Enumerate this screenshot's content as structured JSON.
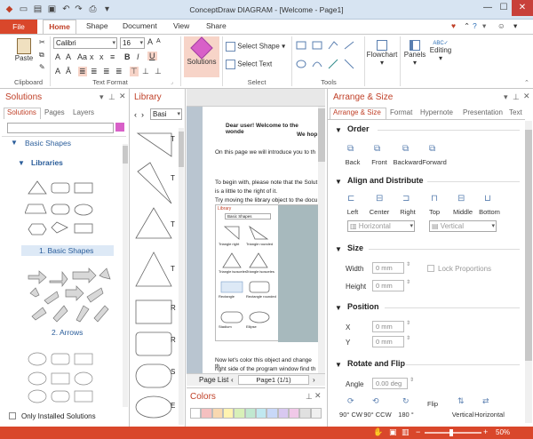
{
  "window": {
    "title": "ConceptDraw DIAGRAM - [Welcome - Page1]",
    "min": "—",
    "max": "☐",
    "close": "✕"
  },
  "tabs": {
    "file": "File",
    "home": "Home",
    "shape": "Shape",
    "document": "Document",
    "view": "View",
    "share": "Share"
  },
  "ribbon": {
    "paste": "Paste",
    "clipboard": "Clipboard",
    "font_name": "Calibri",
    "font_size": "16",
    "text_format": "Text Format",
    "solutions": "Solutions",
    "select_shape": "Select Shape",
    "select_text": "Select Text",
    "select": "Select",
    "tools": "Tools",
    "flowchart": "Flowchart",
    "panels": "Panels",
    "editing": "Editing"
  },
  "solutions": {
    "title": "Solutions",
    "tabs": [
      "Solutions",
      "Pages",
      "Layers"
    ],
    "basic_shapes": "Basic Shapes",
    "libraries": "Libraries",
    "lib1": "1. Basic Shapes",
    "lib2": "2. Arrows",
    "only_installed": "Only Installed Solutions"
  },
  "library": {
    "title": "Library",
    "combo": "Basi",
    "letters": [
      "T",
      "T",
      "T",
      "T",
      "R",
      "R",
      "S",
      "E"
    ]
  },
  "document_text": {
    "greet1": "Dear user! Welcome to the wonde",
    "greet2": "We hop",
    "intro": "On this page we will introduce you to th",
    "p1": "To begin with, please note that the Solut",
    "p2": "is a little to the right of it.",
    "p3": "Try moving the library object to the docu",
    "inner_lib": "Library",
    "inner_combo": "Basic Shapes",
    "inner_items": [
      "Triangle right",
      "Triangle rounded",
      "Triangle isosceles",
      "Triangle isosceles",
      "Rectangle",
      "Rectangle rounded",
      "Stadium",
      "Ellipse"
    ],
    "p4": "Now let's color this object and change th",
    "p5": "right side of the program window find th"
  },
  "page_nav": {
    "list": "Page List",
    "page": "Page1 (1/1)"
  },
  "colors": {
    "title": "Colors"
  },
  "arrange": {
    "title": "Arrange & Size",
    "tabs": [
      "Arrange & Size",
      "Format",
      "Hypernote",
      "Presentation",
      "Text"
    ],
    "order": "Order",
    "order_btns": [
      "Back",
      "Front",
      "Backward",
      "Forward"
    ],
    "align": "Align and Distribute",
    "align_btns": [
      "Left",
      "Center",
      "Right",
      "Top",
      "Middle",
      "Bottom"
    ],
    "horizontal": "Horizontal",
    "vertical": "Vertical",
    "size": "Size",
    "width": "Width",
    "height": "Height",
    "mm": "0 mm",
    "lock": "Lock Proportions",
    "position": "Position",
    "x": "X",
    "y": "Y",
    "rotate": "Rotate and Flip",
    "angle": "Angle",
    "deg": "0.00 deg",
    "rot_btns": [
      "90° CW",
      "90° CCW",
      "180 °",
      "Flip",
      "Vertical",
      "Horizontal"
    ]
  },
  "status": {
    "zoom": "50%"
  },
  "palette": [
    "#ffffff",
    "#f5c0c0",
    "#f8d8b0",
    "#fff3b0",
    "#d8f0b8",
    "#c0e8d0",
    "#c0e8f0",
    "#c8d8f8",
    "#d8c8f0",
    "#f0c8e8",
    "#e0e0e0",
    "#f0f0f0"
  ]
}
